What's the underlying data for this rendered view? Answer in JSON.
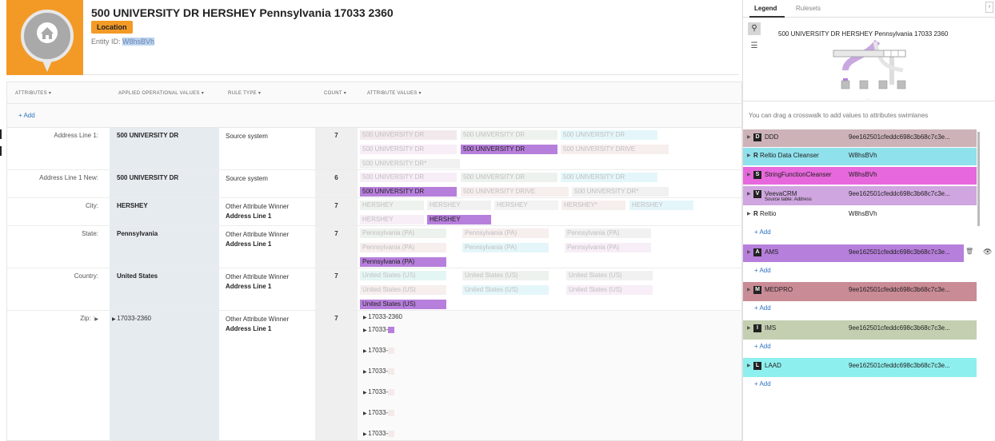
{
  "header": {
    "title": "500 UNIVERSITY DR HERSHEY Pennsylvania 17033 2360",
    "badge": "Location",
    "entity_label": "Entity ID:",
    "entity_id": "W8hsBVh"
  },
  "columns": [
    "ATTRIBUTES",
    "APPLIED OPERATIONAL VALUES",
    "RULE TYPE",
    "COUNT",
    "ATTRIBUTE VALUES"
  ],
  "add_label": "+ Add",
  "rows": [
    {
      "label": "Address Line 1:",
      "op": "500 UNIVERSITY DR",
      "rule": "Source system",
      "rule2": "",
      "count": "7",
      "chips": [
        "500 UNIVERSITY DR",
        "500 UNIVERSITY DR",
        "500 UNIVERSITY DR",
        "500 UNIVERSITY DR",
        "500 UNIVERSITY DR",
        "500 UNIVERSITY DRIVE",
        "500 UNIVERSITY DR*"
      ]
    },
    {
      "label": "Address Line 1 New:",
      "op": "500 UNIVERSITY DR",
      "rule": "Source system",
      "rule2": "",
      "count": "6",
      "chips": [
        "500 UNIVERSITY DR",
        "500 UNIVERSITY DR",
        "500 UNIVERSITY DR",
        "500 UNIVERSITY DR",
        "500 UNIVERSITY DRIVE",
        "500 UNIVERSITY DR*"
      ]
    },
    {
      "label": "City:",
      "op": "HERSHEY",
      "rule": "Other Attribute Winner",
      "rule2": "Address Line 1",
      "count": "7",
      "chips": [
        "HERSHEY",
        "HERSHEY",
        "HERSHEY",
        "HERSHEY*",
        "HERSHEY",
        "HERSHEY",
        "HERSHEY"
      ]
    },
    {
      "label": "State:",
      "op": "Pennsylvania",
      "rule": "Other Attribute Winner",
      "rule2": "Address Line 1",
      "count": "7",
      "chips": [
        "Pennsylvania (PA)",
        "Pennsylvania (PA)",
        "Pennsylvania (PA)",
        "Pennsylvania (PA)",
        "Pennsylvania (PA)",
        "Pennsylvania (PA)",
        "Pennsylvania (PA)"
      ]
    },
    {
      "label": "Country:",
      "op": "United States",
      "rule": "Other Attribute Winner",
      "rule2": "Address Line 1",
      "count": "7",
      "chips": [
        "United States (US)",
        "United States (US)",
        "United States (US)",
        "United States (US)",
        "United States (US)",
        "United States (US)",
        "United States (US)"
      ]
    },
    {
      "label": "Zip:",
      "op": "17033-2360",
      "rule": "Other Attribute Winner",
      "rule2": "Address Line 1",
      "count": "7",
      "zips": [
        "17033-2360",
        "17033-",
        "17033-",
        "17033-",
        "17033-",
        "17033-",
        "17033-"
      ]
    }
  ],
  "legend": {
    "tabs": [
      "Legend",
      "Rulesets"
    ],
    "title": "500 UNIVERSITY DR HERSHEY Pennsylvania 17033 2360",
    "hint": "You can drag a crosswalk to add values to attributes swimlanes",
    "crosswalks": [
      {
        "letter": "D",
        "name": "DDD",
        "sub": "",
        "id": "9ee162501cfeddc698c3b68c7c3e...",
        "color": "#cdb3b8"
      },
      {
        "letter": "R",
        "name": "Reltio Data Cleanser",
        "sub": "",
        "id": "W8hsBVh",
        "color": "#8fe1ec"
      },
      {
        "letter": "S",
        "name": "StringFunctionCleanser",
        "sub": "",
        "id": "W8hsBVh",
        "color": "#e768dc"
      },
      {
        "letter": "V",
        "name": "VeevaCRM",
        "sub": "Source table: Address",
        "id": "9ee162501cfeddc698c3b68c7c3e...",
        "color": "#cfa6df"
      },
      {
        "letter": "R",
        "name": "Reltio",
        "sub": "",
        "id": "W8hsBVh",
        "color": "#ffffff"
      },
      {
        "letter": "A",
        "name": "AMS",
        "sub": "",
        "id": "9ee162501cfeddc698c3b68c7c3e...",
        "color": "#b77fdc"
      },
      {
        "letter": "M",
        "name": "MEDPRO",
        "sub": "",
        "id": "9ee162501cfeddc698c3b68c7c3e...",
        "color": "#c98b95"
      },
      {
        "letter": "I",
        "name": "IMS",
        "sub": "",
        "id": "9ee162501cfeddc698c3b68c7c3e...",
        "color": "#c3cfb0"
      },
      {
        "letter": "L",
        "name": "LAAD",
        "sub": "",
        "id": "9ee162501cfeddc698c3b68c7c3e...",
        "color": "#8ef0ee"
      }
    ]
  }
}
